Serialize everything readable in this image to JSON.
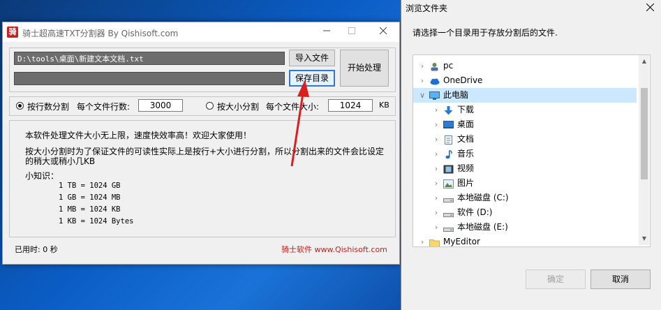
{
  "app": {
    "logo_text": "骑",
    "title": "骑士超高速TXT分割器  By Qishisoft.com",
    "file_path": "D:\\tools\\桌面\\新建文本文档.txt",
    "output_path": "",
    "import_button": "导入文件",
    "save_dir_button": "保存目录",
    "start_button": "开始处理",
    "split_by_lines_label": "按行数分割",
    "lines_per_file_label": "每个文件行数:",
    "lines_per_file_value": "3000",
    "split_by_size_label": "按大小分割",
    "size_per_file_label": "每个文件大小:",
    "size_per_file_value": "1024",
    "size_unit": "KB",
    "split_mode_selected": "lines",
    "info_line1": "本软件处理文件大小无上限，速度快效率高！欢迎大家使用！",
    "info_line2a": "按大小分割时为了保证文件的可读性实际上是按行+大小进行分割，所以分割出来的文件会比设定",
    "info_line2b": "的稍大或稍小几KB",
    "tips_title": "小知识：",
    "tips": [
      "1 TB = 1024 GB",
      "1 GB = 1024 MB",
      "1 MB = 1024 KB",
      "1 KB = 1024 Bytes"
    ],
    "elapsed": "已用时: 0 秒",
    "brand": "骑士软件 www.Qishisoft.com"
  },
  "dialog": {
    "title": "浏览文件夹",
    "prompt": "请选择一个目录用于存放分割后的文件.",
    "tree": [
      {
        "label": "pc",
        "icon": "user-icon",
        "expanded": false,
        "indent": 0,
        "selected": false
      },
      {
        "label": "OneDrive",
        "icon": "onedrive-icon",
        "expanded": false,
        "indent": 0,
        "selected": false
      },
      {
        "label": "此电脑",
        "icon": "computer-icon",
        "expanded": true,
        "indent": 0,
        "selected": true
      },
      {
        "label": "下载",
        "icon": "download-icon",
        "expanded": false,
        "indent": 1,
        "selected": false
      },
      {
        "label": "桌面",
        "icon": "desktop-icon",
        "expanded": false,
        "indent": 1,
        "selected": false
      },
      {
        "label": "文档",
        "icon": "document-icon",
        "expanded": false,
        "indent": 1,
        "selected": false
      },
      {
        "label": "音乐",
        "icon": "music-icon",
        "expanded": false,
        "indent": 1,
        "selected": false
      },
      {
        "label": "视频",
        "icon": "video-icon",
        "expanded": false,
        "indent": 1,
        "selected": false
      },
      {
        "label": "图片",
        "icon": "picture-icon",
        "expanded": false,
        "indent": 1,
        "selected": false
      },
      {
        "label": "本地磁盘 (C:)",
        "icon": "drive-icon",
        "expanded": false,
        "indent": 1,
        "selected": false
      },
      {
        "label": "软件 (D:)",
        "icon": "drive-icon",
        "expanded": false,
        "indent": 1,
        "selected": false
      },
      {
        "label": "本地磁盘 (E:)",
        "icon": "drive-icon",
        "expanded": false,
        "indent": 1,
        "selected": false
      },
      {
        "label": "MyEditor",
        "icon": "folder-icon",
        "expanded": false,
        "indent": 0,
        "selected": false
      }
    ],
    "ok_button": "确定",
    "cancel_button": "取消"
  }
}
